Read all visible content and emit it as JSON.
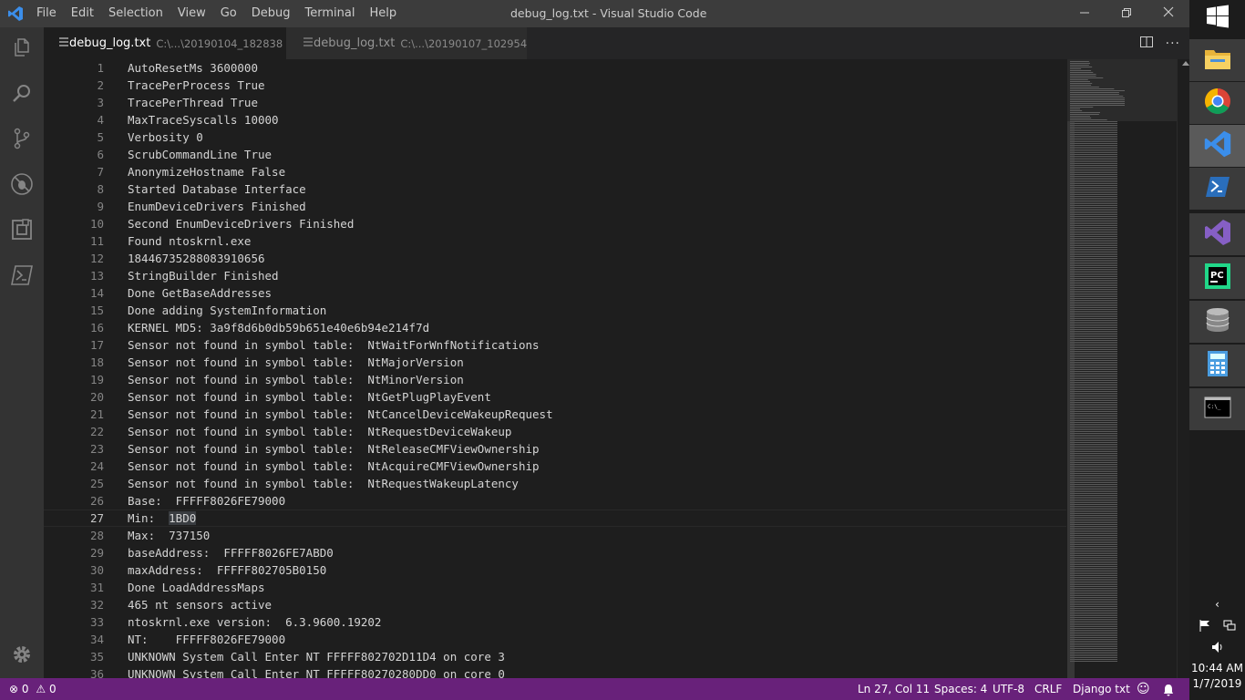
{
  "window": {
    "title": "debug_log.txt - Visual Studio Code",
    "minimize_icon": "minimize-icon",
    "maximize_icon": "restore-icon",
    "close_icon": "close-icon"
  },
  "menu": [
    "File",
    "Edit",
    "Selection",
    "View",
    "Go",
    "Debug",
    "Terminal",
    "Help"
  ],
  "activity_bar": [
    "explorer-icon",
    "search-icon",
    "source-control-icon",
    "debug-icon",
    "extensions-icon",
    "powershell-icon",
    "gear-icon"
  ],
  "tabs": [
    {
      "label": "debug_log.txt",
      "description": "C:\\...\\20190104_182838",
      "active": true
    },
    {
      "label": "debug_log.txt",
      "description": "C:\\...\\20190107_102954",
      "active": false
    }
  ],
  "tab_actions": [
    "split-editor-icon",
    "more-actions-icon"
  ],
  "editor": {
    "current_line": 27,
    "lines": [
      "AutoResetMs 3600000",
      "TracePerProcess True",
      "TracePerThread True",
      "MaxTraceSyscalls 10000",
      "Verbosity 0",
      "ScrubCommandLine True",
      "AnonymizeHostname False",
      "Started Database Interface",
      "EnumDeviceDrivers Finished",
      "Second EnumDeviceDrivers Finished",
      "Found ntoskrnl.exe",
      "18446735288083910656",
      "StringBuilder Finished",
      "Done GetBaseAddresses",
      "Done adding SystemInformation",
      "KERNEL MD5: 3a9f8d6b0db59b651e40e6b94e214f7d",
      "Sensor not found in symbol table:  NtWaitForWnfNotifications",
      "Sensor not found in symbol table:  NtMajorVersion",
      "Sensor not found in symbol table:  NtMinorVersion",
      "Sensor not found in symbol table:  NtGetPlugPlayEvent",
      "Sensor not found in symbol table:  NtCancelDeviceWakeupRequest",
      "Sensor not found in symbol table:  NtRequestDeviceWakeup",
      "Sensor not found in symbol table:  NtReleaseCMFViewOwnership",
      "Sensor not found in symbol table:  NtAcquireCMFViewOwnership",
      "Sensor not found in symbol table:  NtRequestWakeupLatency",
      "Base:  FFFFF8026FE79000",
      "Min:  1BD0",
      "Max:  737150",
      "baseAddress:  FFFFF8026FE7ABD0",
      "maxAddress:  FFFFF802705B0150",
      "Done LoadAddressMaps",
      "465 nt sensors active",
      "ntoskrnl.exe version:  6.3.9600.19202",
      "NT:    FFFFF8026FE79000",
      "UNKNOWN System Call Enter NT FFFFF802702D11D4 on core 3",
      "UNKNOWN System Call Enter NT FFFFF80270280DD0 on core 0"
    ]
  },
  "status_bar": {
    "errors": "0",
    "warnings": "0",
    "position": "Ln 27, Col 11",
    "spaces": "Spaces: 4",
    "encoding": "UTF-8",
    "eol": "CRLF",
    "language": "Django txt",
    "feedback_icon": "smiley-icon",
    "notifications_icon": "bell-icon"
  },
  "taskbar": {
    "start_icon": "windows-start-icon",
    "apps": [
      "file-explorer-icon",
      "chrome-icon",
      "vscode-icon",
      "powershell-icon",
      "visual-studio-icon",
      "pycharm-icon",
      "database-icon",
      "calculator-icon",
      "command-prompt-icon"
    ],
    "tray": {
      "chevron": "‹",
      "time": "10:44 AM",
      "date": "1/7/2019"
    }
  },
  "colors": {
    "status_bar": "#68217a",
    "editor_bg": "#1e1e1e",
    "activity_bar": "#333333",
    "title_bar": "#3c3c3c"
  }
}
